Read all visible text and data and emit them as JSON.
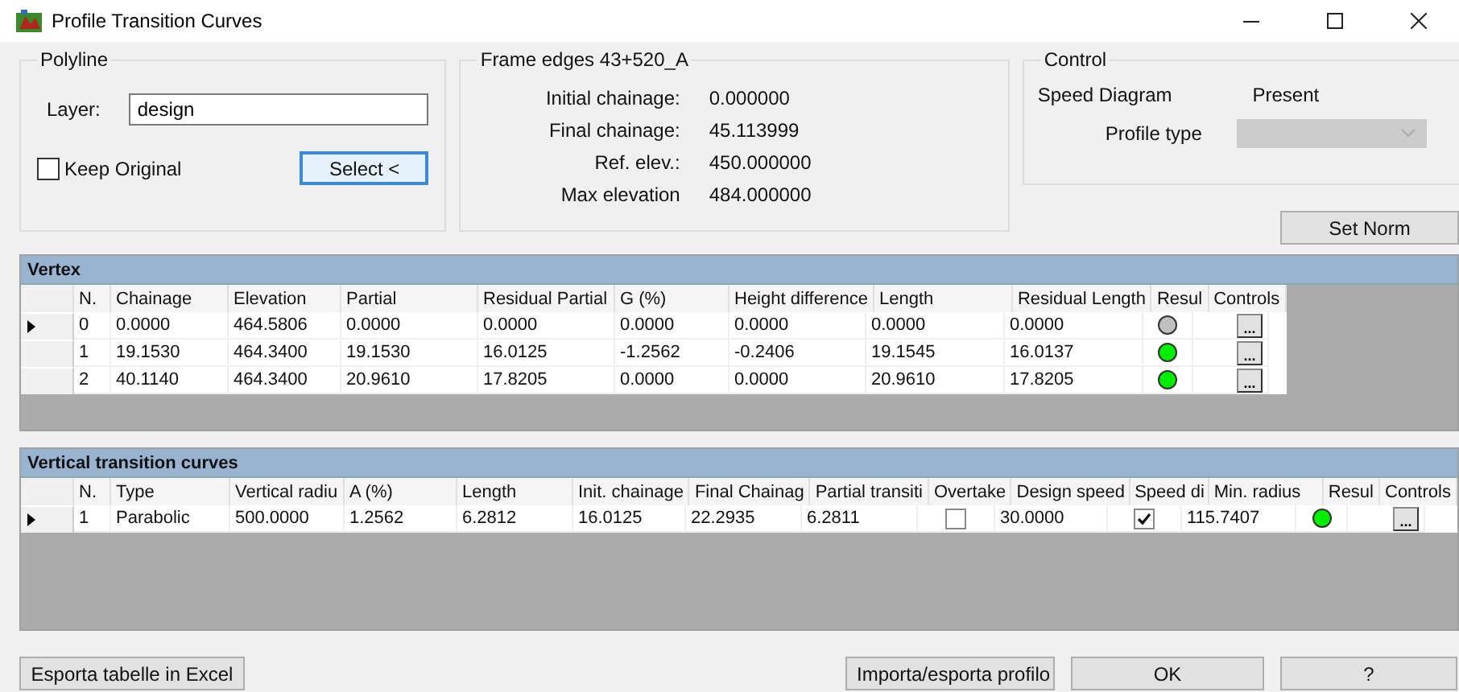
{
  "window": {
    "title": "Profile Transition Curves"
  },
  "polyline": {
    "title": "Polyline",
    "layer_label": "Layer:",
    "layer_value": "design",
    "keep_original": {
      "label": "Keep Original",
      "checked": false
    },
    "select_button": "Select <"
  },
  "frame_edges": {
    "title": "Frame edges 43+520_A",
    "rows": [
      {
        "label": "Initial chainage:",
        "value": "0.000000"
      },
      {
        "label": "Final chainage:",
        "value": "45.113999"
      },
      {
        "label": "Ref. elev.:",
        "value": "450.000000"
      },
      {
        "label": "Max elevation",
        "value": "484.000000"
      }
    ]
  },
  "control": {
    "title": "Control",
    "speed_label": "Speed Diagram",
    "speed_value": "Present",
    "profile_label": "Profile type",
    "profile_type": {
      "disabled": true
    }
  },
  "set_norm_button": "Set Norm",
  "vertex": {
    "title": "Vertex",
    "columns": [
      "N.",
      "Chainage",
      "Elevation",
      "Partial",
      "Residual Partial",
      "G (%)",
      "Height difference",
      "Length",
      "Residual Length",
      "Resul",
      "Controls"
    ],
    "rows": [
      {
        "selected": true,
        "cells": [
          {
            "kind": "text",
            "text": "0"
          },
          {
            "kind": "text",
            "text": "0.0000"
          },
          {
            "kind": "text",
            "text": "464.5806"
          },
          {
            "kind": "text",
            "text": "0.0000"
          },
          {
            "kind": "text",
            "text": "0.0000"
          },
          {
            "kind": "text",
            "text": "0.0000"
          },
          {
            "kind": "text",
            "text": "0.0000"
          },
          {
            "kind": "text",
            "text": "0.0000"
          },
          {
            "kind": "text",
            "text": "0.0000"
          },
          {
            "kind": "status",
            "color": "#c0c0c0"
          },
          {
            "kind": "button",
            "text": "..."
          }
        ]
      },
      {
        "selected": false,
        "cells": [
          {
            "kind": "text",
            "text": "1"
          },
          {
            "kind": "text",
            "text": "19.1530"
          },
          {
            "kind": "text",
            "text": "464.3400"
          },
          {
            "kind": "text",
            "text": "19.1530"
          },
          {
            "kind": "text",
            "text": "16.0125"
          },
          {
            "kind": "text",
            "text": "-1.2562"
          },
          {
            "kind": "text",
            "text": "-0.2406"
          },
          {
            "kind": "text",
            "text": "19.1545"
          },
          {
            "kind": "text",
            "text": "16.0137"
          },
          {
            "kind": "status",
            "color": "#00ee00"
          },
          {
            "kind": "button",
            "text": "..."
          }
        ]
      },
      {
        "selected": false,
        "cells": [
          {
            "kind": "text",
            "text": "2"
          },
          {
            "kind": "text",
            "text": "40.1140"
          },
          {
            "kind": "text",
            "text": "464.3400"
          },
          {
            "kind": "text",
            "text": "20.9610"
          },
          {
            "kind": "text",
            "text": "17.8205"
          },
          {
            "kind": "text",
            "text": "0.0000"
          },
          {
            "kind": "text",
            "text": "0.0000"
          },
          {
            "kind": "text",
            "text": "20.9610"
          },
          {
            "kind": "text",
            "text": "17.8205"
          },
          {
            "kind": "status",
            "color": "#00ee00"
          },
          {
            "kind": "button",
            "text": "..."
          }
        ]
      }
    ]
  },
  "transition_curves": {
    "title": "Vertical transition curves",
    "columns": [
      "N.",
      "Type",
      "Vertical radiu",
      "A (%)",
      "Length",
      "Init. chainage",
      "Final Chainag",
      "Partial transiti",
      "Overtake",
      "Design speed",
      "Speed di",
      "Min. radius",
      "Resul",
      "Controls"
    ],
    "rows": [
      {
        "selected": true,
        "cells": [
          {
            "kind": "text",
            "text": "1"
          },
          {
            "kind": "text",
            "text": "Parabolic"
          },
          {
            "kind": "text",
            "text": "500.0000"
          },
          {
            "kind": "text",
            "text": "1.2562"
          },
          {
            "kind": "text",
            "text": "6.2812"
          },
          {
            "kind": "text",
            "text": "16.0125"
          },
          {
            "kind": "text",
            "text": "22.2935"
          },
          {
            "kind": "text",
            "text": "6.2811"
          },
          {
            "kind": "check",
            "checked": false
          },
          {
            "kind": "text",
            "text": "30.0000"
          },
          {
            "kind": "check",
            "checked": true
          },
          {
            "kind": "text",
            "text": "115.7407"
          },
          {
            "kind": "status",
            "color": "#00ee00"
          },
          {
            "kind": "button",
            "text": "..."
          }
        ]
      }
    ]
  },
  "bottom_buttons": [
    "Esporta tabelle in Excel",
    "Importa/esporta profilo",
    "OK",
    "?"
  ]
}
